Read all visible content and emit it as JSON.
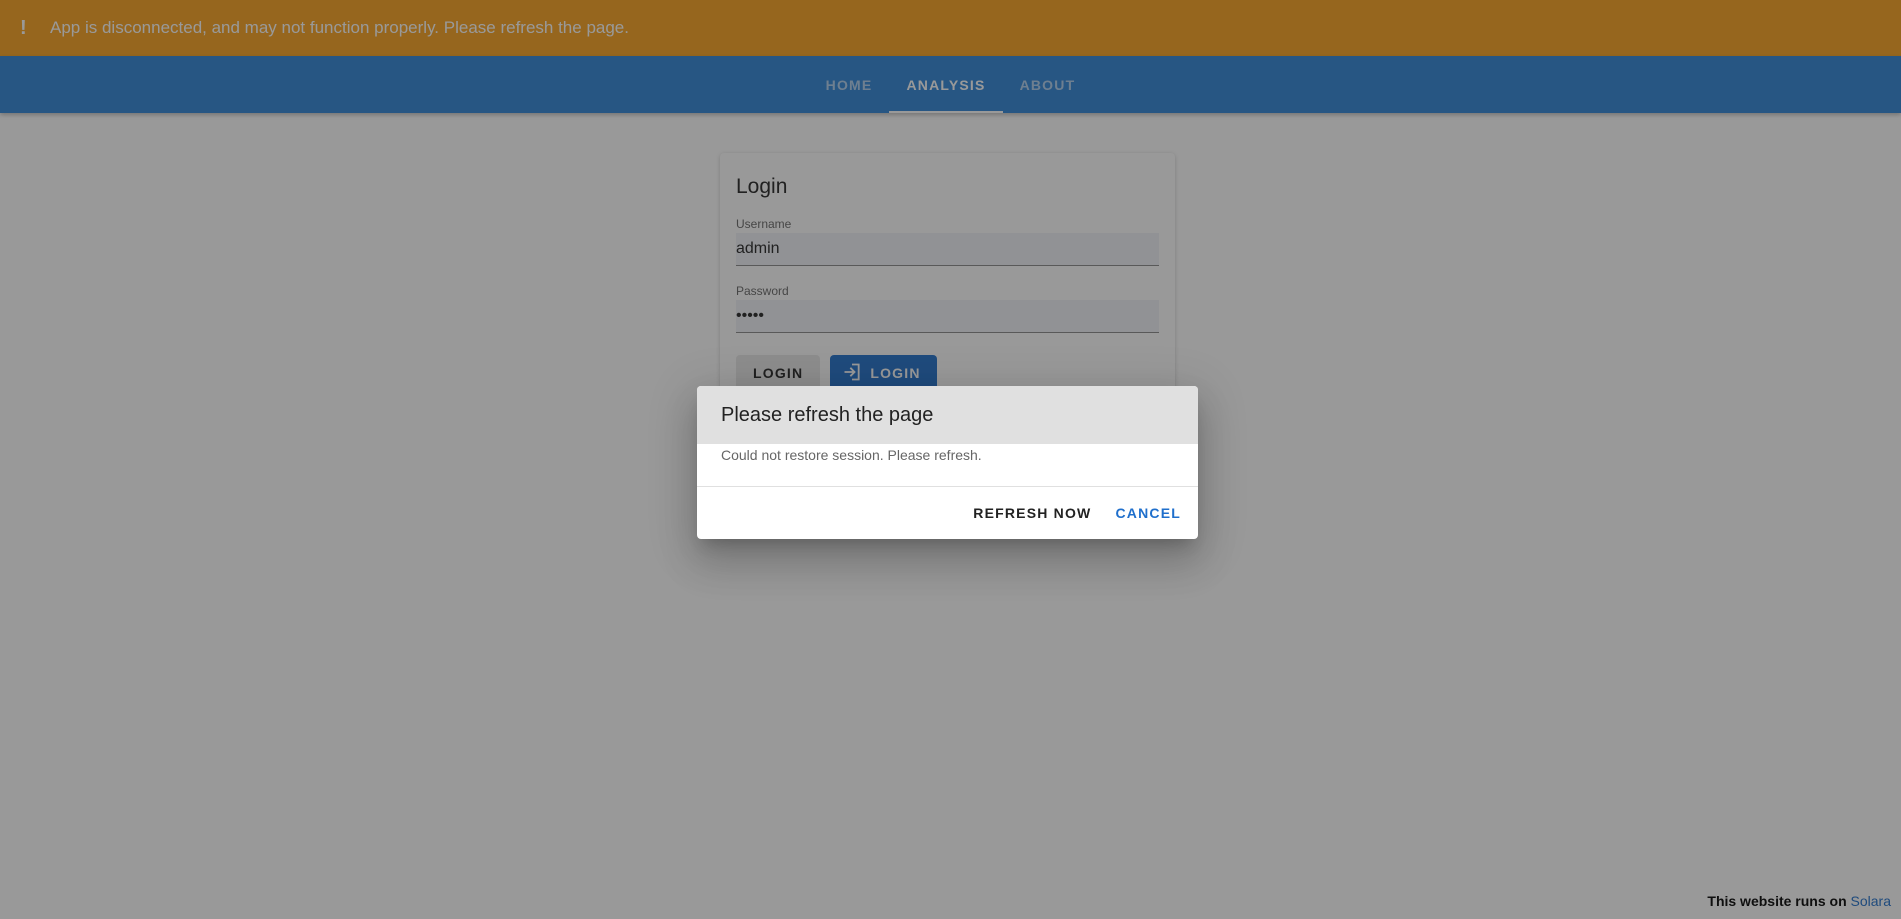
{
  "banner": {
    "icon": "exclamation-icon",
    "icon_glyph": "!",
    "message": "App is disconnected, and may not function properly. Please refresh the page.",
    "color": "#f9a21c"
  },
  "nav": {
    "color": "#2e84d6",
    "tabs": [
      {
        "label": "HOME",
        "active": false
      },
      {
        "label": "ANALYSIS",
        "active": true
      },
      {
        "label": "ABOUT",
        "active": false
      }
    ]
  },
  "login": {
    "title": "Login",
    "username_label": "Username",
    "username_value": "admin",
    "password_label": "Password",
    "password_value": "•••••",
    "button_plain": "LOGIN",
    "button_primary": "LOGIN",
    "button_primary_icon": "login-icon",
    "accent": "#1f6fcc"
  },
  "dialog": {
    "title": "Please refresh the page",
    "message": "Could not restore session. Please refresh.",
    "refresh_label": "REFRESH NOW",
    "cancel_label": "CANCEL"
  },
  "footer": {
    "text": "This website runs on ",
    "link": "Solara"
  }
}
